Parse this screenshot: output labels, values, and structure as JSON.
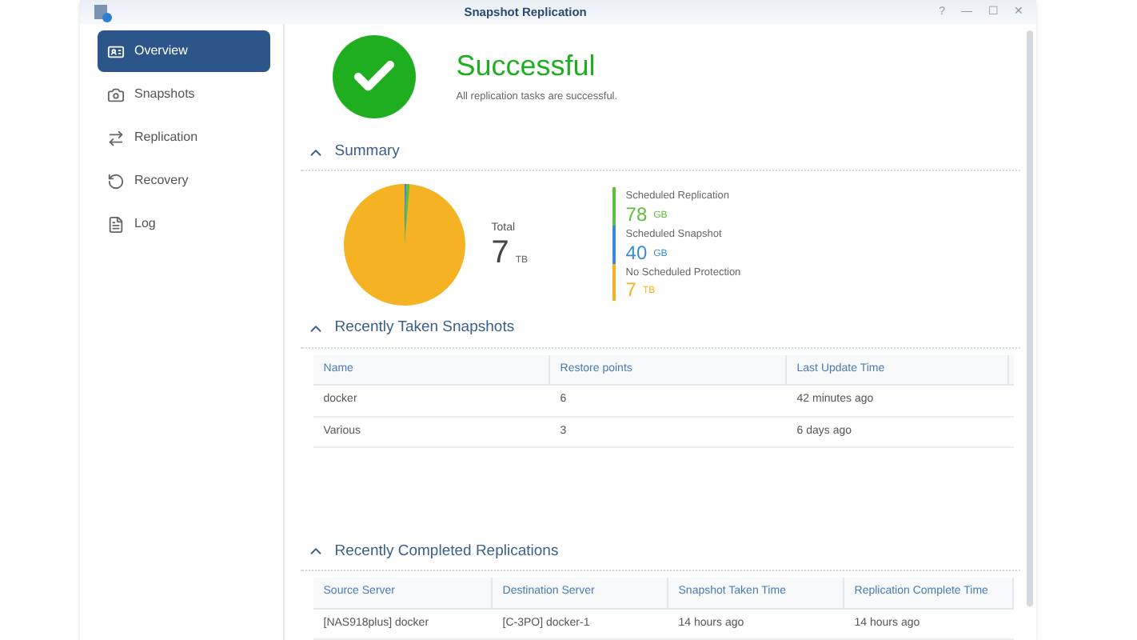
{
  "window": {
    "title": "Snapshot Replication",
    "controls": [
      "?",
      "—",
      "☐",
      "✕"
    ]
  },
  "sidebar": {
    "items": [
      {
        "label": "Overview",
        "selected": true
      },
      {
        "label": "Snapshots",
        "selected": false
      },
      {
        "label": "Replication",
        "selected": false
      },
      {
        "label": "Recovery",
        "selected": false
      },
      {
        "label": "Log",
        "selected": false
      }
    ]
  },
  "status": {
    "title": "Successful",
    "message": "All replication tasks are successful."
  },
  "summary": {
    "heading": "Summary",
    "total_label": "Total",
    "total_value": "7",
    "total_unit": "TB",
    "legend": [
      {
        "label": "Scheduled Replication",
        "value": "78",
        "unit": "GB",
        "color": "#5fbf3f"
      },
      {
        "label": "Scheduled Snapshot",
        "value": "40",
        "unit": "GB",
        "color": "#3b8ad8"
      },
      {
        "label": "No Scheduled Protection",
        "value": "7",
        "unit": "TB",
        "color": "#f5b324"
      }
    ]
  },
  "snapshots": {
    "heading": "Recently Taken Snapshots",
    "columns": [
      "Name",
      "Restore points",
      "Last Update Time"
    ],
    "rows": [
      [
        "docker",
        "6",
        "42 minutes ago"
      ],
      [
        "Various",
        "3",
        "6 days ago"
      ]
    ]
  },
  "replications": {
    "heading": "Recently Completed Replications",
    "columns": [
      "Source Server",
      "Destination Server",
      "Snapshot Taken Time",
      "Replication Complete Time"
    ],
    "rows": [
      [
        "[NAS918plus] docker",
        "[C-3PO] docker-1",
        "14 hours ago",
        "14 hours ago"
      ]
    ]
  }
}
